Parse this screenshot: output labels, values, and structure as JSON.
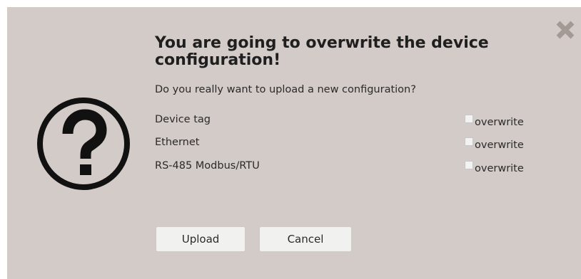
{
  "dialog": {
    "title": "You are going to overwrite the device configuration!",
    "subtitle": "Do you really want to upload a new configuration?",
    "options": [
      {
        "label": "Device tag",
        "check_label": "overwrite",
        "checked": false
      },
      {
        "label": "Ethernet",
        "check_label": "overwrite",
        "checked": false
      },
      {
        "label": "RS-485 Modbus/RTU",
        "check_label": "overwrite",
        "checked": false
      }
    ],
    "buttons": {
      "upload_label": "Upload",
      "cancel_label": "Cancel"
    },
    "icons": {
      "close": "close-icon",
      "question": "question-icon"
    },
    "colors": {
      "background": "#d3cbc7",
      "button_bg": "#f1f1ef",
      "text": "#2a2a2a",
      "close_icon": "#a39a96"
    }
  }
}
